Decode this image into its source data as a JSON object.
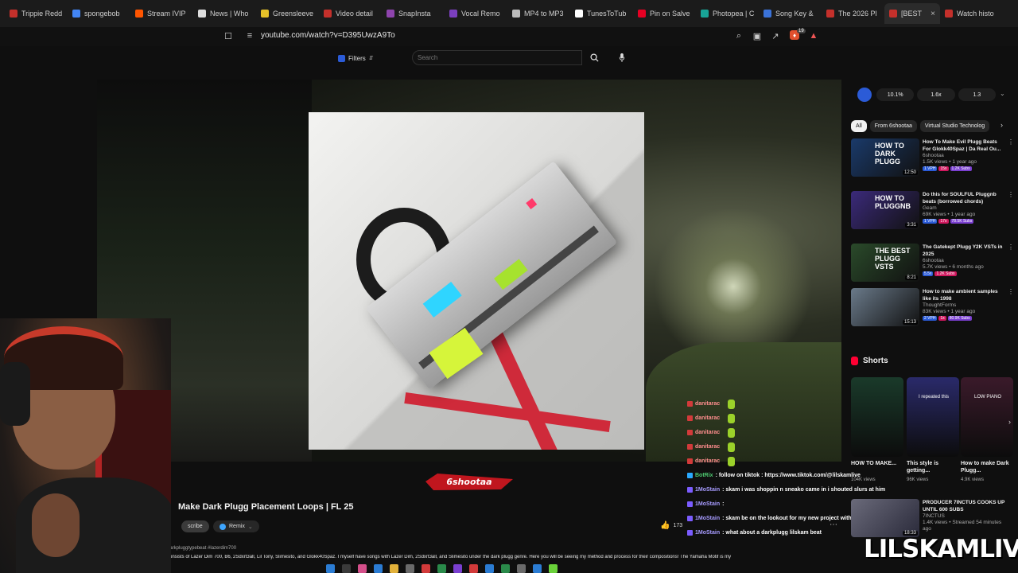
{
  "browser": {
    "tabs": [
      {
        "label": "Trippie Redd",
        "color": "#c4302b"
      },
      {
        "label": "spongebob",
        "color": "#4285f4"
      },
      {
        "label": "Stream IVIP",
        "color": "#ff5500"
      },
      {
        "label": "News | Who",
        "color": "#dddddd"
      },
      {
        "label": "Greensleeve",
        "color": "#e6c229"
      },
      {
        "label": "Video detail",
        "color": "#c4302b"
      },
      {
        "label": "SnapInsta",
        "color": "#8e44ad"
      },
      {
        "label": "Vocal Remo",
        "color": "#7b3fbf"
      },
      {
        "label": "MP4 to MP3",
        "color": "#bbbbbb"
      },
      {
        "label": "TunesToTub",
        "color": "#ffffff"
      },
      {
        "label": "Pin on Salve",
        "color": "#e60023"
      },
      {
        "label": "Photopea | C",
        "color": "#18a497"
      },
      {
        "label": "Song Key &",
        "color": "#3b73d9"
      },
      {
        "label": "The 2026 Pl",
        "color": "#c4302b"
      },
      {
        "label": "[BEST",
        "color": "#c4302b",
        "active": true
      },
      {
        "label": "Watch histo",
        "color": "#c4302b"
      }
    ],
    "url": "youtube.com/watch?v=D395UwzA9To",
    "ext_badge": "19"
  },
  "youtube": {
    "filters_label": "Filters",
    "search_placeholder": "Search"
  },
  "video": {
    "title": "Make Dark Plugg Placement Loops | FL 25",
    "subscribe_label": "scribe",
    "remix_label": "Remix",
    "likes": "173",
    "hashtags": "darkpluggtypebeat #lazerdim700",
    "description": "consists of Lazer Dim 700, B6, 2Sdxrt3all, Lil Tony, Slimesito, and Glokk40Spaz. I myself have songs with Lazer Dim, 2Sdxrt3all, and Slimesito under the dark plugg genre. Here you will be seeing my method and process for their compositions! The Yamaha Motif is my",
    "logo_text": "6shootaa"
  },
  "chat": [
    {
      "user": "danitarac",
      "msg": "",
      "kind": "user"
    },
    {
      "user": "danitarac",
      "msg": "",
      "kind": "user"
    },
    {
      "user": "danitarac",
      "msg": "",
      "kind": "user"
    },
    {
      "user": "danitarac",
      "msg": "",
      "kind": "user"
    },
    {
      "user": "danitarac",
      "msg": "",
      "kind": "user"
    },
    {
      "user": "BotRix",
      "msg": ": follow on tiktok : https://www.tiktok.com/@lilskamlive",
      "kind": "bot"
    },
    {
      "user": "1MoStain",
      "msg": ": skam i was shoppin n sneako came in i shouted slurs at him",
      "kind": "mo"
    },
    {
      "user": "1MoStain",
      "msg": ":",
      "kind": "mo"
    },
    {
      "user": "1MoStain",
      "msg": ": skam be on the lookout for my new project with smokinskulok",
      "kind": "mo"
    },
    {
      "user": "1MoStain",
      "msg": ": what about a darkplugg lilskam beat",
      "kind": "mo"
    }
  ],
  "sidebar": {
    "speed_chips": [
      "10.1%",
      "1.6x",
      "1.3"
    ],
    "filter_chips": [
      "All",
      "From 6shootaa",
      "Virtual Studio Technolog"
    ],
    "recs": [
      {
        "title": "How To Make Evil Plugg Beats For Glokk40Spaz | Da Real Ou...",
        "channel": "6shootaa",
        "meta": "1.5K views • 1 year ago",
        "badges": [
          "1 VPH",
          "15x",
          "1.2K Subs"
        ],
        "duration": "12:50",
        "thumb_text": "HOW TO DARK PLUGG",
        "thumb_color": "#1a3a6a"
      },
      {
        "title": "Do this for SOULFUL Pluggnb beats (borrowed chords)",
        "channel": "Geam",
        "meta": "69K views • 1 year ago",
        "badges": [
          "1 VPH",
          "17x",
          "78.5K Subs"
        ],
        "duration": "3:31",
        "thumb_text": "HOW TO PLUGGNB",
        "thumb_color": "#3b2a7a"
      },
      {
        "title": "The Gatekept Plugg Y2K VSTs in 2025",
        "channel": "6shootaa",
        "meta": "5.7K views • 6 months ago",
        "badges": [
          "5.5x",
          "1.2K Subs"
        ],
        "duration": "8:21",
        "thumb_text": "THE BEST PLUGG VSTS",
        "thumb_color": "#2a4a2a"
      },
      {
        "title": "How to make ambient samples like its 1998",
        "channel": "ThoughtForms",
        "meta": "83K views • 1 year ago",
        "badges": [
          "2 VPH",
          "1x",
          "80.9K Subs"
        ],
        "duration": "15:13",
        "thumb_text": "",
        "thumb_color": "#6a7a8a"
      }
    ],
    "shorts_label": "Shorts",
    "shorts": [
      {
        "title": "HOW TO MAKE...",
        "views": "104K views",
        "color": "#1a3a2a"
      },
      {
        "title": "This style is getting...",
        "views": "96K views",
        "color": "#2a2a6a",
        "overlay": "I repeated this"
      },
      {
        "title": "How to make Dark Plugg...",
        "views": "4.9K views",
        "color": "#3a1a2a",
        "overlay": "LOW PIANO"
      }
    ],
    "producer": {
      "title": "PRODUCER 7INCTUS COOKS UP UNTIL 600 SUBS",
      "channel": "7INCTUS",
      "meta": "1.4K views • Streamed 54 minutes ago",
      "duration": "18:33"
    }
  },
  "stream": {
    "watermark": "LILSKAMLIVE"
  }
}
